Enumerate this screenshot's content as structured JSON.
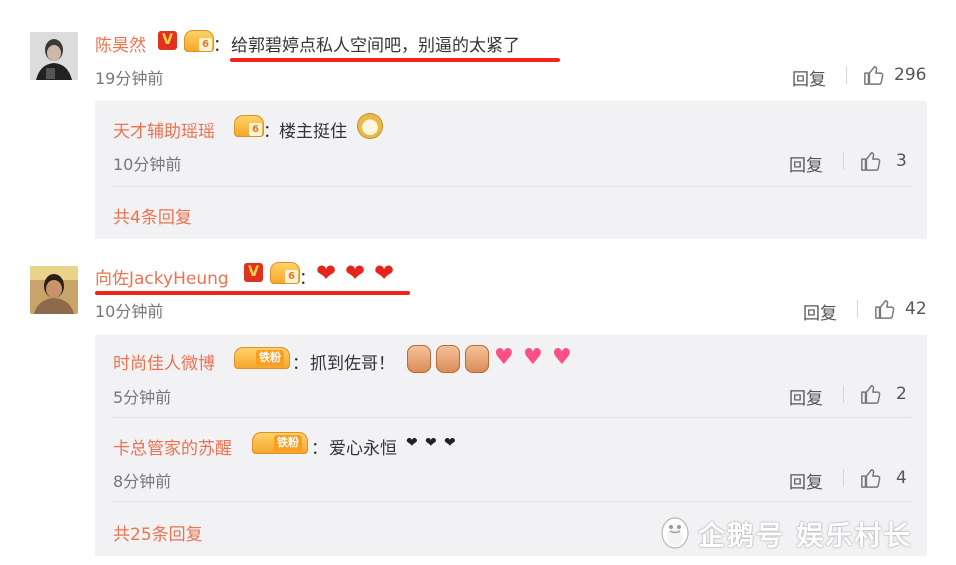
{
  "comments": [
    {
      "user": "陈昊然",
      "text": "给郭碧婷点私人空间吧，别逼的太紧了",
      "time": "19分钟前",
      "reply_label": "回复",
      "likes": "296",
      "replies": [
        {
          "user": "天才辅助瑶瑶",
          "text": "楼主挺住",
          "time": "10分钟前",
          "reply_label": "回复",
          "likes": "3"
        }
      ],
      "more_replies": "共4条回复"
    },
    {
      "user": "向佐JackyHeung",
      "text": "",
      "time": "10分钟前",
      "reply_label": "回复",
      "likes": "42",
      "replies": [
        {
          "user": "时尚佳人微博",
          "text": "抓到佐哥！",
          "time": "5分钟前",
          "reply_label": "回复",
          "likes": "2"
        },
        {
          "user": "卡总管家的苏醒",
          "text": "爱心永恒",
          "time": "8分钟前",
          "reply_label": "回复",
          "likes": "4"
        }
      ],
      "more_replies": "共25条回复"
    }
  ],
  "badges": {
    "verified": "V",
    "fan_level": "6",
    "iron_fan": "铁粉"
  },
  "separator": "：",
  "watermark": "企鹅号 娱乐村长",
  "colors": {
    "username": "#eb7350",
    "underline": "#f3231b",
    "panel": "#f2f2f5"
  },
  "icons": [
    "thumbs-up-icon",
    "verified-v-icon",
    "fan-badge-icon",
    "heart-emoji-icon",
    "doge-emoji-icon",
    "penguin-logo-icon"
  ]
}
